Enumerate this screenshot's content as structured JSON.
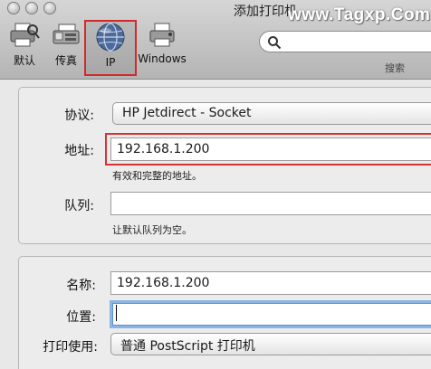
{
  "window": {
    "title": "添加打印机",
    "watermark": "www.Tagxp.Com"
  },
  "toolbar": {
    "items": [
      {
        "label": "默认",
        "icon": "default-printer-icon"
      },
      {
        "label": "传真",
        "icon": "fax-icon"
      },
      {
        "label": "IP",
        "icon": "ip-globe-icon",
        "selected": true
      },
      {
        "label": "Windows",
        "icon": "windows-printer-icon"
      }
    ],
    "search_caption": "搜索"
  },
  "form": {
    "protocol": {
      "label": "协议:",
      "value": "HP Jetdirect - Socket"
    },
    "address": {
      "label": "地址:",
      "value": "192.168.1.200",
      "hint": "有效和完整的地址。"
    },
    "queue": {
      "label": "队列:",
      "value": "",
      "hint": "让默认队列为空。"
    },
    "name": {
      "label": "名称:",
      "value": "192.168.1.200"
    },
    "location": {
      "label": "位置:",
      "value": ""
    },
    "print_using": {
      "label": "打印使用:",
      "value": "普通 PostScript 打印机"
    }
  },
  "colors": {
    "highlight": "#d22a2a",
    "focus": "#8cb4e4"
  }
}
